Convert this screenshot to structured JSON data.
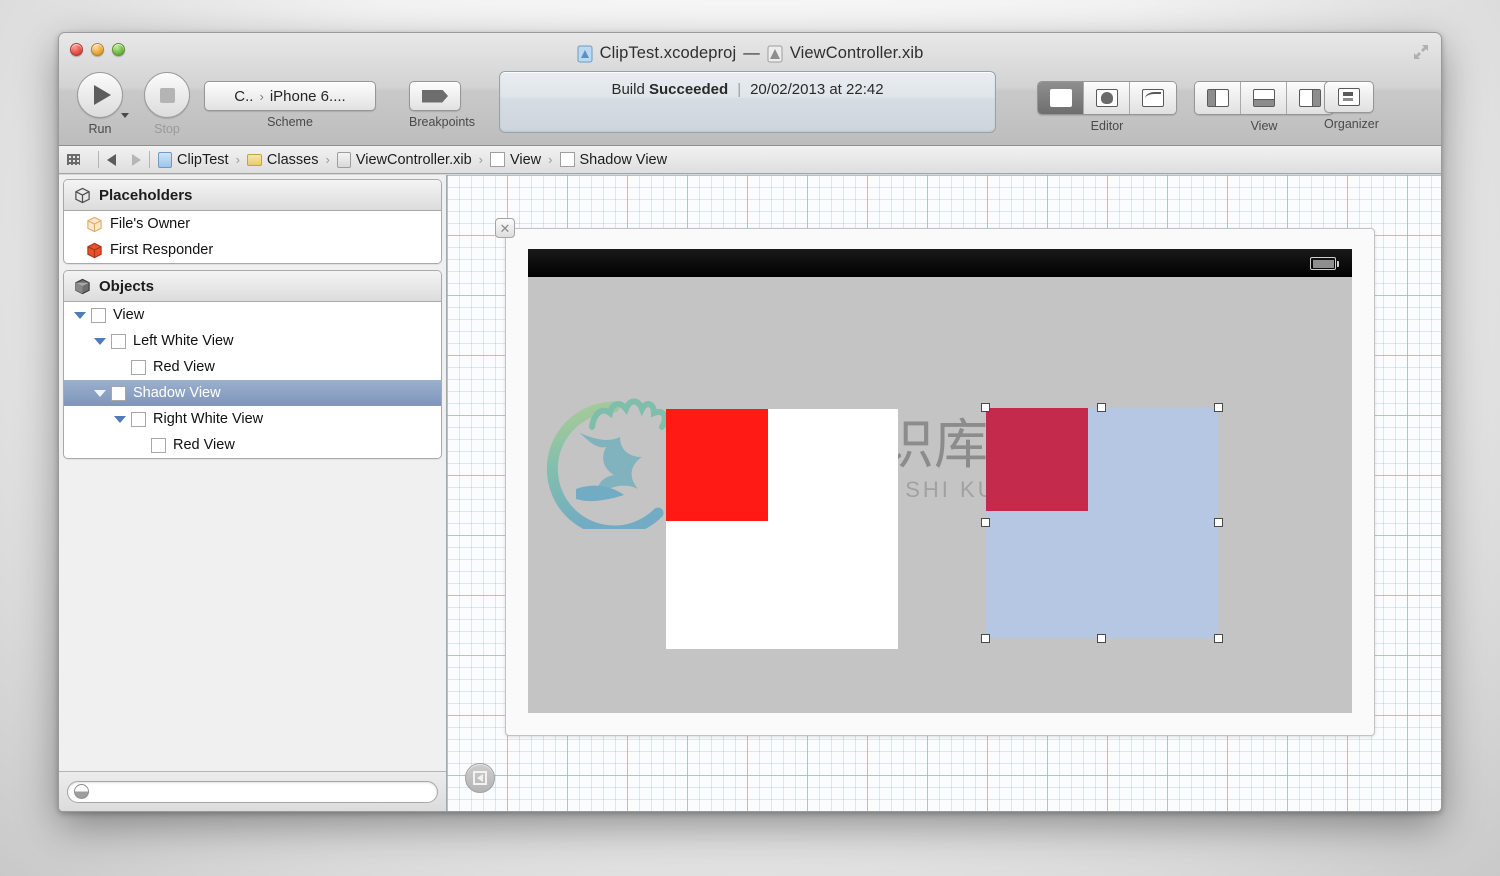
{
  "window": {
    "title_project": "ClipTest.xcodeproj",
    "title_dash": "—",
    "title_file": "ViewController.xib"
  },
  "toolbar": {
    "run_label": "Run",
    "stop_label": "Stop",
    "scheme_label": "Scheme",
    "scheme_project": "C..",
    "scheme_sep": "›",
    "scheme_destination": "iPhone 6....",
    "breakpoints_label": "Breakpoints",
    "editor_label": "Editor",
    "view_label": "View",
    "organizer_label": "Organizer"
  },
  "status": {
    "build_prefix": "Build",
    "build_result": "Succeeded",
    "separator": "|",
    "timestamp": "20/02/2013 at 22:42"
  },
  "breadcrumb": {
    "items": [
      {
        "label": "ClipTest",
        "icon": "project-icon"
      },
      {
        "label": "Classes",
        "icon": "folder-icon"
      },
      {
        "label": "ViewController.xib",
        "icon": "xib-icon"
      },
      {
        "label": "View",
        "icon": "view-square-icon"
      },
      {
        "label": "Shadow View",
        "icon": "view-square-icon"
      }
    ],
    "separator": "›"
  },
  "sidebar": {
    "placeholders": {
      "header": "Placeholders",
      "items": [
        {
          "label": "File's Owner",
          "icon": "cube-outline-icon"
        },
        {
          "label": "First Responder",
          "icon": "cube-red-icon"
        }
      ]
    },
    "objects": {
      "header": "Objects",
      "tree": [
        {
          "label": "View",
          "depth": 0,
          "expanded": true,
          "selected": false
        },
        {
          "label": "Left White View",
          "depth": 1,
          "expanded": true,
          "selected": false
        },
        {
          "label": "Red View",
          "depth": 2,
          "expanded": null,
          "selected": false
        },
        {
          "label": "Shadow View",
          "depth": 1,
          "expanded": true,
          "selected": true
        },
        {
          "label": "Right White View",
          "depth": 2,
          "expanded": true,
          "selected": false
        },
        {
          "label": "Red View",
          "depth": 3,
          "expanded": null,
          "selected": false
        }
      ]
    },
    "filter_placeholder": "",
    "filter_value": ""
  },
  "canvas": {
    "close_badge": "✕",
    "views": {
      "left_white_view": "Left White View",
      "left_red_view": "Red View",
      "shadow_view": "Shadow View",
      "right_red_view": "Red View"
    }
  },
  "watermark": {
    "chinese": "小牛知识库",
    "pinyin": "XIAO NIU ZHI SHI KU"
  },
  "colors": {
    "selection_row": "#7e96ba",
    "selected_view_tint": "#b2c7e6",
    "red_view": "#ff1a15",
    "red_view_tinted": "#c32a4c",
    "white_view": "#ffffff",
    "device_background": "#c4c4c4",
    "status_bar": "#000000"
  }
}
